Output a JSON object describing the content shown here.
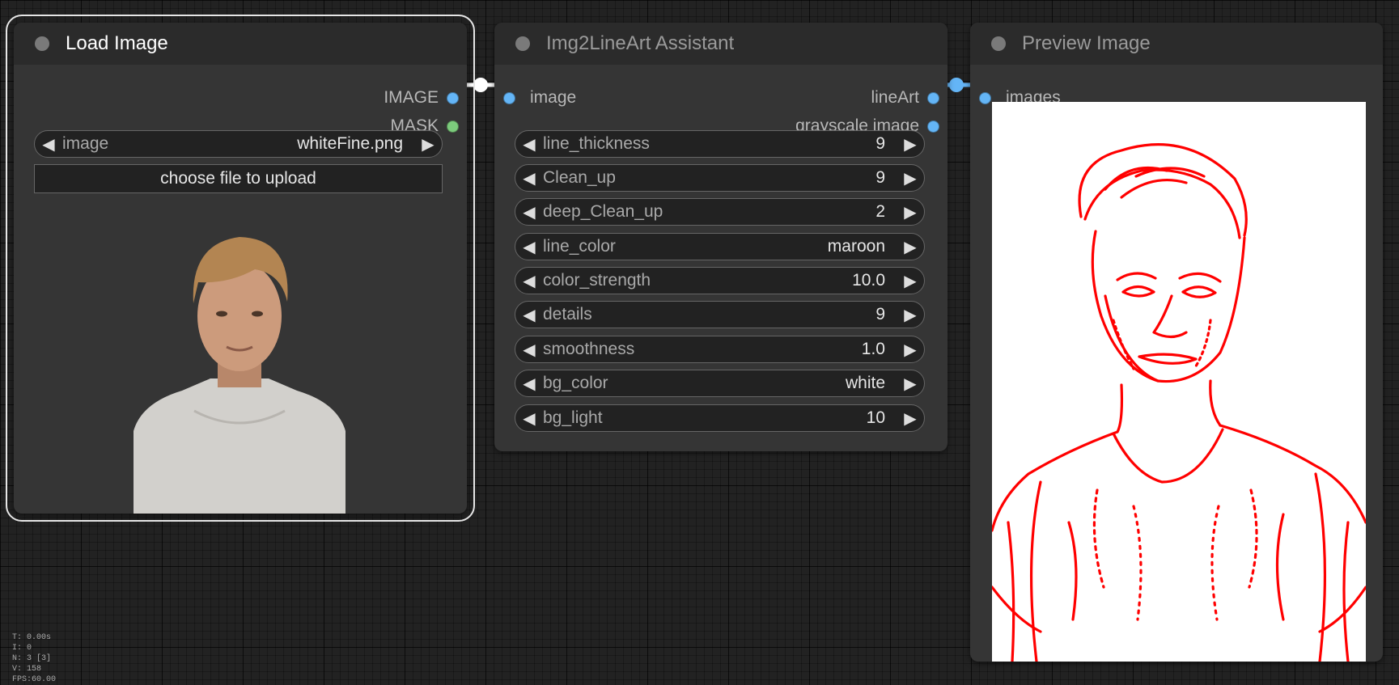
{
  "nodes": {
    "load_image": {
      "title": "Load Image",
      "outputs": [
        "IMAGE",
        "MASK"
      ],
      "widget": {
        "label": "image",
        "value": "whiteFine.png"
      },
      "upload_button": "choose file to upload",
      "preview_icon": "portrait-photo-icon"
    },
    "lineart": {
      "title": "Img2LineArt Assistant",
      "input": "image",
      "outputs": [
        "lineArt",
        "grayscale image"
      ],
      "widgets": [
        {
          "label": "line_thickness",
          "value": "9"
        },
        {
          "label": "Clean_up",
          "value": "9"
        },
        {
          "label": "deep_Clean_up",
          "value": "2"
        },
        {
          "label": "line_color",
          "value": "maroon"
        },
        {
          "label": "color_strength",
          "value": "10.0"
        },
        {
          "label": "details",
          "value": "9"
        },
        {
          "label": "smoothness",
          "value": "1.0"
        },
        {
          "label": "bg_color",
          "value": "white"
        },
        {
          "label": "bg_light",
          "value": "10"
        }
      ]
    },
    "preview": {
      "title": "Preview Image",
      "input": "images",
      "preview_icon": "lineart-preview-icon"
    }
  },
  "stats": {
    "t": "T: 0.00s",
    "i": "I: 0",
    "n": "N: 3 [3]",
    "v": "V: 158",
    "fps": "FPS:60.00"
  },
  "colors": {
    "canvas": "#222222",
    "node_body": "#353535",
    "node_title": "#2b2b2b",
    "slot_image": "#64b5f6",
    "slot_mask": "#7ccb7c",
    "line_art": "#ff0000"
  }
}
